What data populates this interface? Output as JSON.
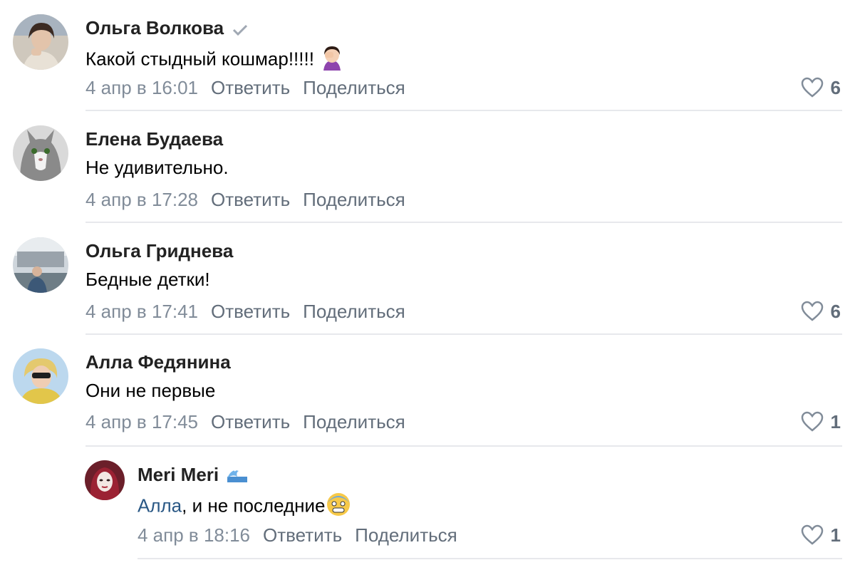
{
  "comments": [
    {
      "author": "Ольга Волкова",
      "text": "Какой стыдный кошмар!!!!!",
      "date": "4 апр в 16:01",
      "reply": "Ответить",
      "share": "Поделиться",
      "likes": "6",
      "verified": true,
      "emoji": "facepalm-woman-icon"
    },
    {
      "author": "Елена Будаева",
      "text": "Не удивительно.",
      "date": "4 апр в 17:28",
      "reply": "Ответить",
      "share": "Поделиться",
      "likes": ""
    },
    {
      "author": "Ольга Гриднева",
      "text": "Бедные детки!",
      "date": "4 апр в 17:41",
      "reply": "Ответить",
      "share": "Поделиться",
      "likes": "6"
    },
    {
      "author": "Алла Федянина",
      "text": "Они не первые",
      "date": "4 апр в 17:45",
      "reply": "Ответить",
      "share": "Поделиться",
      "likes": "1"
    },
    {
      "author": "Meri Meri",
      "mention": "Алла",
      "text": ", и не последние",
      "date": "4 апр в 18:16",
      "reply": "Ответить",
      "share": "Поделиться",
      "likes": "1",
      "emoji": "fearful-face-icon",
      "author_badge": "wave-icon"
    }
  ],
  "colors": {
    "link": "#2a5885",
    "meta": "#818c99",
    "action": "#626d7a",
    "divider": "#e7e8ec"
  }
}
